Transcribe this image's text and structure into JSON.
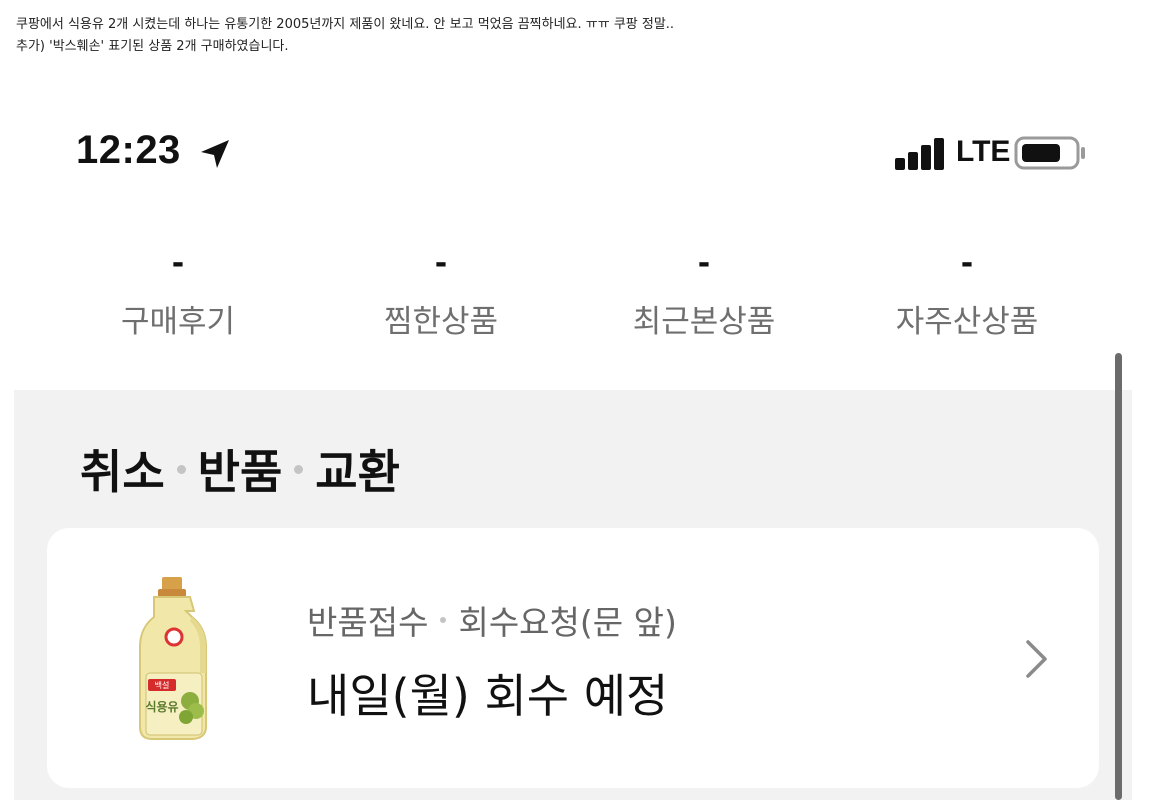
{
  "post": {
    "line1": "쿠팡에서 식용유 2개 시켰는데 하나는 유통기한 2005년까지 제품이 왔네요. 안 보고 먹었음 끔찍하네요. ㅠㅠ 쿠팡 정말..",
    "line2": "추가) '박스훼손' 표기된 상품 2개 구매하였습니다."
  },
  "status_bar": {
    "time": "12:23",
    "network": "LTE",
    "icons": [
      "location-arrow-icon",
      "signal-icon",
      "battery-icon"
    ]
  },
  "stats": [
    {
      "value": "-",
      "label": "구매후기"
    },
    {
      "value": "-",
      "label": "찜한상품"
    },
    {
      "value": "-",
      "label": "최근본상품"
    },
    {
      "value": "-",
      "label": "자주산상품"
    }
  ],
  "section": {
    "title_parts": [
      "취소",
      "반품",
      "교환"
    ]
  },
  "order_card": {
    "status_parts": [
      "반품접수",
      "회수요청(문 앞)"
    ],
    "pickup_text": "내일(월) 회수 예정",
    "product_label": "식용유",
    "product_brand": "백설",
    "icon": "chevron-right-icon"
  },
  "colors": {
    "section_bg": "#f2f2f2",
    "card_bg": "#ffffff",
    "label_gray": "#6f6f6f",
    "text_dark": "#111111"
  }
}
